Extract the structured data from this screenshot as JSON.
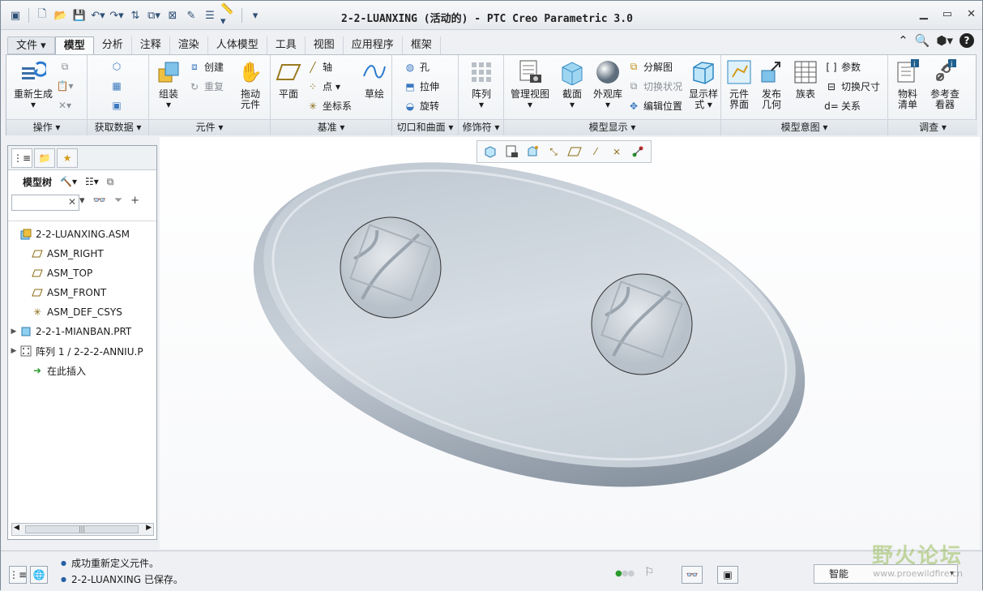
{
  "window": {
    "title": "2-2-LUANXING (活动的) - PTC Creo Parametric 3.0",
    "controls": [
      "minimize-icon",
      "maximize-icon",
      "close-icon"
    ]
  },
  "tabs": [
    {
      "label": "文件",
      "kind": "file"
    },
    {
      "label": "模型",
      "kind": "active"
    },
    {
      "label": "分析"
    },
    {
      "label": "注释"
    },
    {
      "label": "渲染"
    },
    {
      "label": "人体模型"
    },
    {
      "label": "工具"
    },
    {
      "label": "视图"
    },
    {
      "label": "应用程序"
    },
    {
      "label": "框架"
    }
  ],
  "ribbon": {
    "groups": {
      "operations": "操作",
      "get_data": "获取数据",
      "component": "元件",
      "datum": "基准",
      "cut_surface": "切口和曲面",
      "modifiers": "修饰符",
      "model_display": "模型显示",
      "model_intent": "模型意图",
      "investigate": "调查"
    },
    "buttons": {
      "regenerate": "重新生成",
      "assemble": "组装",
      "create": "创建",
      "repeat": "重复",
      "drag_components": "拖动\n元件",
      "plane": "平面",
      "axis": "轴",
      "point": "点",
      "csys": "坐标系",
      "sketch": "草绘",
      "hole": "孔",
      "extrude": "拉伸",
      "revolve": "旋转",
      "pattern": "阵列",
      "manage_views": "管理视图",
      "section": "截面",
      "appearance": "外观库",
      "exploded_view": "分解图",
      "toggle_status": "切换状况",
      "edit_position": "编辑位置",
      "display_style": "显示样\n式",
      "component_interface": "元件\n界面",
      "publish_geometry": "发布\n几何",
      "family_table": "族表",
      "parameters": "参数",
      "switch_dimensions": "切换尺寸",
      "relations": "关系",
      "bill_of_materials": "物料\n清单",
      "reference_viewer": "参考查\n看器"
    }
  },
  "model_tree": {
    "header": "模型树",
    "filter_placeholder": "",
    "items": [
      {
        "label": "2-2-LUANXING.ASM",
        "icon": "assembly-icon",
        "indent": 0,
        "expand": ""
      },
      {
        "label": "ASM_RIGHT",
        "icon": "datum-plane-icon",
        "indent": 1,
        "expand": ""
      },
      {
        "label": "ASM_TOP",
        "icon": "datum-plane-icon",
        "indent": 1,
        "expand": ""
      },
      {
        "label": "ASM_FRONT",
        "icon": "datum-plane-icon",
        "indent": 1,
        "expand": ""
      },
      {
        "label": "ASM_DEF_CSYS",
        "icon": "csys-icon",
        "indent": 1,
        "expand": ""
      },
      {
        "label": "2-2-1-MIANBAN.PRT",
        "icon": "part-icon",
        "indent": 1,
        "expand": "▶"
      },
      {
        "label": "阵列 1 / 2-2-2-ANNIU.P",
        "icon": "pattern-icon",
        "indent": 1,
        "expand": "▶"
      },
      {
        "label": "在此插入",
        "icon": "insert-here-icon",
        "indent": 1,
        "expand": ""
      }
    ]
  },
  "status": {
    "messages": [
      "成功重新定义元件。",
      "2-2-LUANXING 已保存。"
    ],
    "selection_filter": "智能"
  },
  "watermark": {
    "text": "野火论坛",
    "url": "www.proewildfire.cn"
  }
}
